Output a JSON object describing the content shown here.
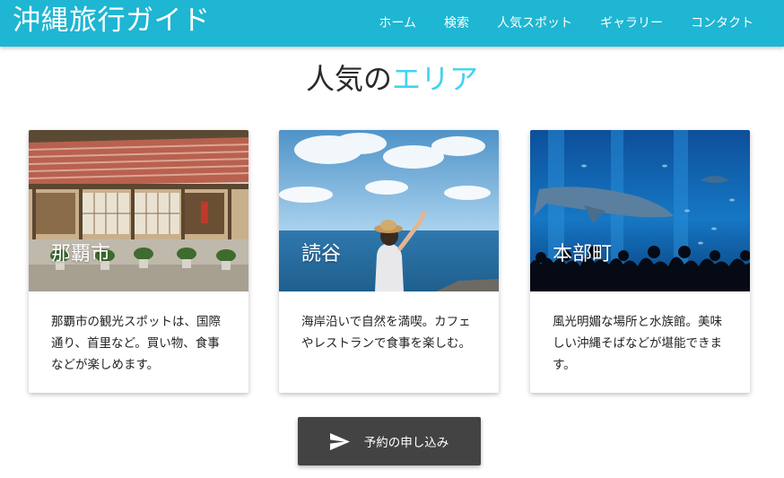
{
  "header": {
    "brand": "沖縄旅行ガイド",
    "nav": [
      "ホーム",
      "検索",
      "人気スポット",
      "ギャラリー",
      "コンタクト"
    ]
  },
  "section": {
    "title_main": "人気の",
    "title_accent": "エリア"
  },
  "cards": [
    {
      "title": "那覇市",
      "description": "那覇市の観光スポットは、国際通り、首里など。買い物、食事などが楽しめます。"
    },
    {
      "title": "読谷",
      "description": "海岸沿いで自然を満喫。カフェやレストランで食事を楽しむ。"
    },
    {
      "title": "本部町",
      "description": "風光明媚な場所と水族館。美味しい沖縄そばなどが堪能できます。"
    }
  ],
  "actions": {
    "reserve_label": "予約の申し込み",
    "reserve_icon": "send-icon"
  },
  "colors": {
    "navbar": "#1eb6d2",
    "accent": "#42d3ee",
    "button": "#434343"
  }
}
